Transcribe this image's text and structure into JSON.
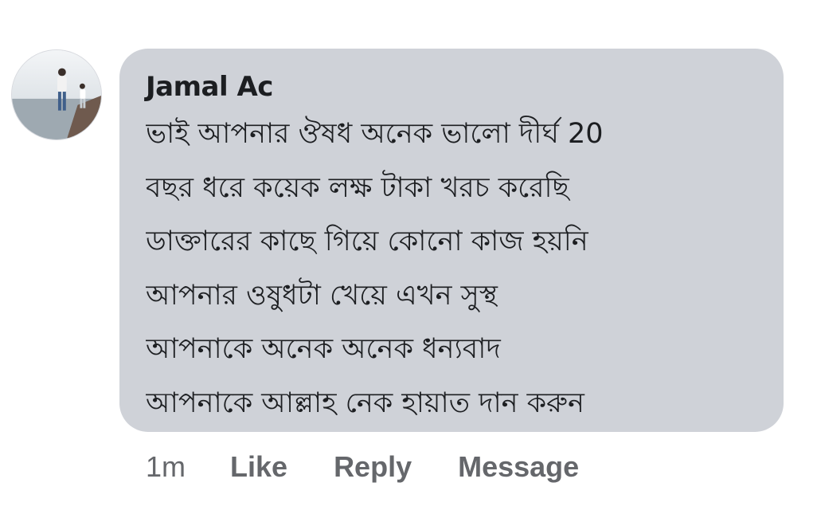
{
  "comment": {
    "author": "Jamal Ac",
    "lines": [
      "ভাই আপনার ঔষধ   অনেক ভালো দীর্ঘ 20",
      "বছর ধরে কয়েক লক্ষ টাকা খরচ করেছি",
      "ডাক্তারের কাছে গিয়ে কোনো কাজ হয়নি",
      "আপনার ওষুধটা খেয়ে এখন সুস্থ",
      "আপনাকে অনেক অনেক ধন্যবাদ",
      "আপনাকে আল্লাহ নেক হায়াত দান করুন"
    ],
    "timestamp": "1m",
    "actions": {
      "like": "Like",
      "reply": "Reply",
      "message": "Message"
    }
  },
  "colors": {
    "bubble": "#cfd2d8",
    "text": "#1c1e21",
    "meta": "#65676b"
  }
}
